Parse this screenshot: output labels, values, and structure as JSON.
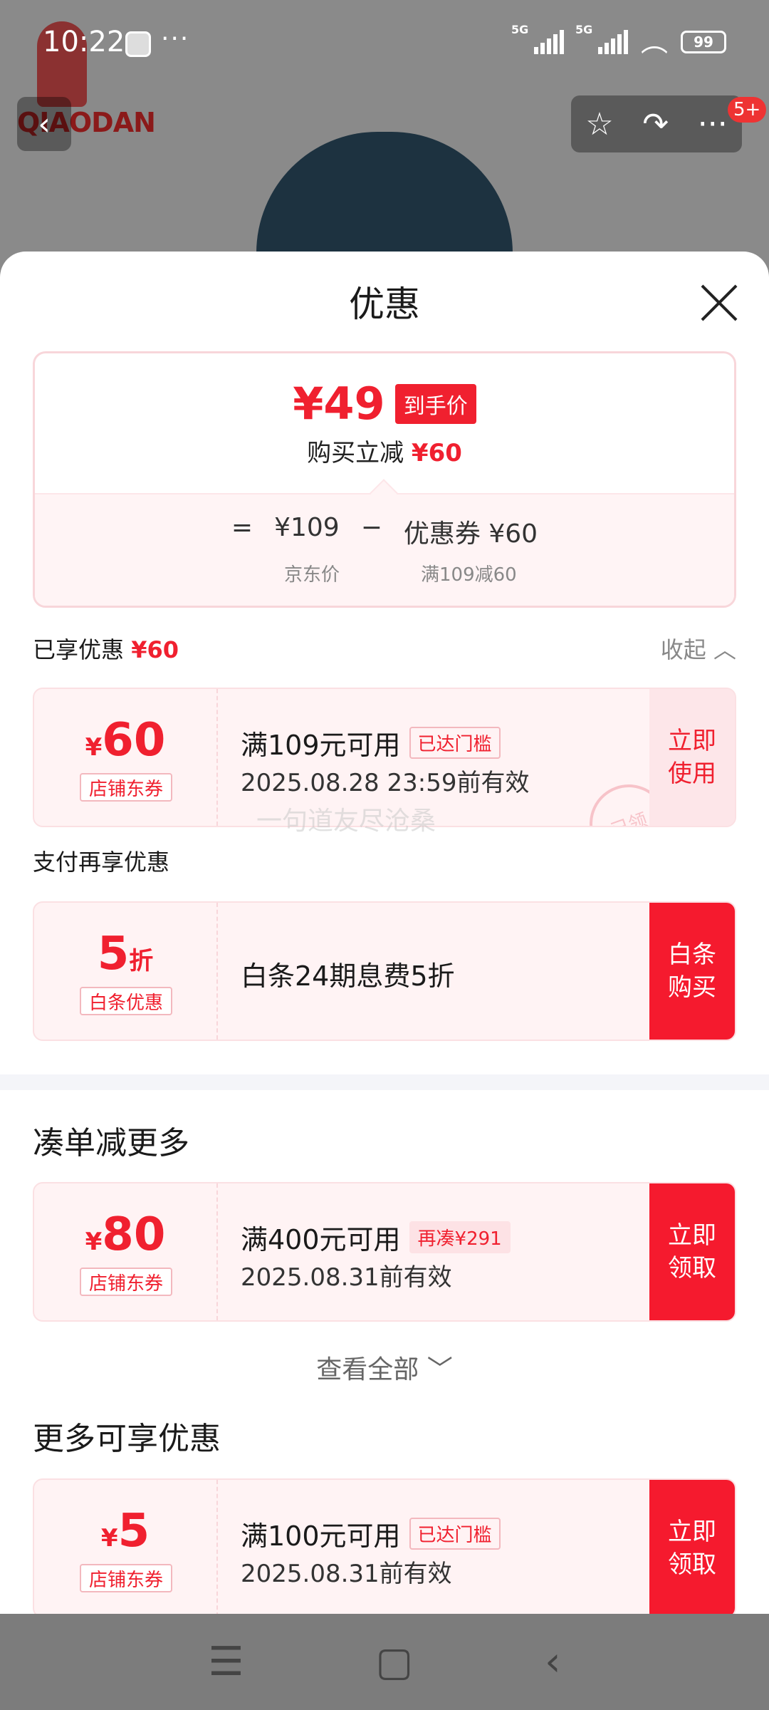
{
  "status_bar": {
    "time": "10:22",
    "dots": "···",
    "net1": "5G",
    "net2": "5G",
    "battery": "99"
  },
  "product_page": {
    "brand": "QIAODAN",
    "cart_badge": "5+"
  },
  "sheet": {
    "title": "优惠",
    "summary": {
      "final_price": "¥49",
      "final_tag": "到手价",
      "buy_cut_label": "购买立减",
      "buy_cut_value": "¥60",
      "eq": "=",
      "jd_price": "¥109",
      "minus": "−",
      "coupon_formula": "优惠券 ¥60",
      "jd_price_label": "京东价",
      "coupon_formula_label": "满109减60"
    },
    "enjoyed_label": "已享优惠",
    "enjoyed_value": "¥60",
    "collapse_label": "收起",
    "coupon1": {
      "currency": "¥",
      "amount": "60",
      "type": "店铺东券",
      "condition": "满109元可用",
      "cond_tag": "已达门槛",
      "expiry": "2025.08.28 23:59前有效",
      "cta": "立即 使用",
      "stamp": "已领"
    },
    "watermark": "一句道友尽沧桑",
    "pay_label": "支付再享优惠",
    "coupon2": {
      "amount": "5",
      "unit": "折",
      "type": "白条优惠",
      "desc": "白条24期息费5折",
      "cta": "白条 购买"
    },
    "more_title": "凑单减更多",
    "coupon3": {
      "currency": "¥",
      "amount": "80",
      "type": "店铺东券",
      "condition": "满400元可用",
      "cond_tag": "再凑¥291",
      "expiry": "2025.08.31前有效",
      "cta": "立即 领取"
    },
    "see_all": "查看全部",
    "extra_title": "更多可享优惠",
    "coupon4": {
      "currency": "¥",
      "amount": "5",
      "type": "店铺东券",
      "condition": "满100元可用",
      "cond_tag": "已达门槛",
      "expiry": "2025.08.31前有效",
      "cta": "立即 领取"
    }
  },
  "nav_bar": {
    "menu_icon": "☰",
    "home_icon": "▢",
    "back_icon": "‹"
  }
}
